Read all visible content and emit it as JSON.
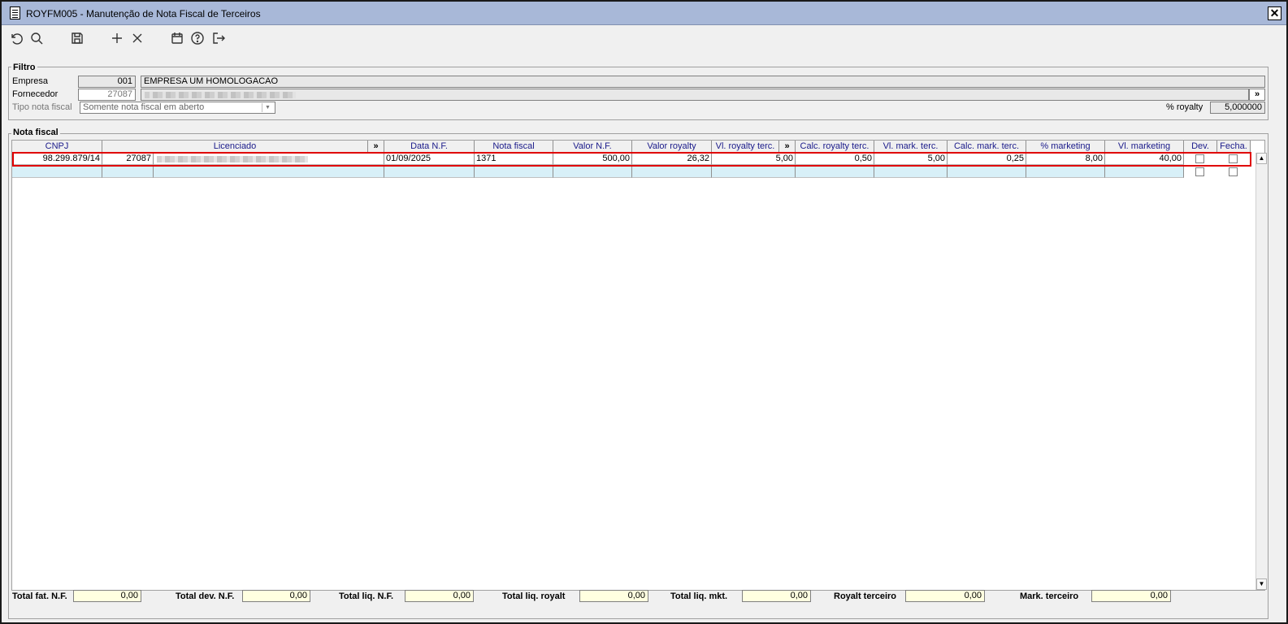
{
  "window": {
    "title": "ROYFM005 - Manutenção de Nota Fiscal de Terceiros",
    "close_label": "✕"
  },
  "toolbar": {
    "icons": [
      "undo-icon",
      "search-icon",
      "save-icon",
      "add-icon",
      "delete-icon",
      "calendar-icon",
      "help-icon",
      "exit-icon"
    ]
  },
  "filtro": {
    "group_label": "Filtro",
    "empresa_label": "Empresa",
    "empresa_code": "001",
    "empresa_name": "EMPRESA UM HOMOLOGACAO",
    "fornecedor_label": "Fornecedor",
    "fornecedor_code": "27087",
    "tipo_label": "Tipo nota fiscal",
    "tipo_value": "Somente nota fiscal em aberto",
    "royalty_label": "% royalty",
    "royalty_value": "5,000000",
    "expand_label": "»"
  },
  "nota_fiscal": {
    "group_label": "Nota fiscal",
    "columns": {
      "cnpj": "CNPJ",
      "licenciado": "Licenciado",
      "expand1": "»",
      "data_nf": "Data N.F.",
      "nota_fiscal": "Nota fiscal",
      "valor_nf": "Valor N.F.",
      "valor_royalty": "Valor royalty",
      "vl_royalty_terc": "Vl. royalty terc.",
      "expand2": "»",
      "calc_royalty_terc": "Calc. royalty terc.",
      "vl_mark_terc": "Vl. mark. terc.",
      "calc_mark_terc": "Calc. mark. terc.",
      "pct_marketing": "% marketing",
      "vl_marketing": "Vl. marketing",
      "dev": "Dev.",
      "fecha": "Fecha."
    },
    "rows": [
      {
        "cnpj": "98.299.879/14",
        "codigo": "27087",
        "data_nf": "01/09/2025",
        "nota_fiscal": "1371",
        "valor_nf": "500,00",
        "valor_royalty": "26,32",
        "vl_royalty_terc": "5,00",
        "calc_royalty_terc": "0,50",
        "vl_mark_terc": "5,00",
        "calc_mark_terc": "0,25",
        "pct_marketing": "8,00",
        "vl_marketing": "40,00"
      }
    ]
  },
  "totals": {
    "fat_label": "Total fat. N.F.",
    "fat_value": "0,00",
    "dev_label": "Total dev. N.F.",
    "dev_value": "0,00",
    "liq_label": "Total liq. N.F.",
    "liq_value": "0,00",
    "liq_royalt_label": "Total liq. royalt",
    "liq_royalt_value": "0,00",
    "liq_mkt_label": "Total liq. mkt.",
    "liq_mkt_value": "0,00",
    "royalt_terc_label": "Royalt terceiro",
    "royalt_terc_value": "0,00",
    "mark_terc_label": "Mark. terceiro",
    "mark_terc_value": "0,00"
  }
}
